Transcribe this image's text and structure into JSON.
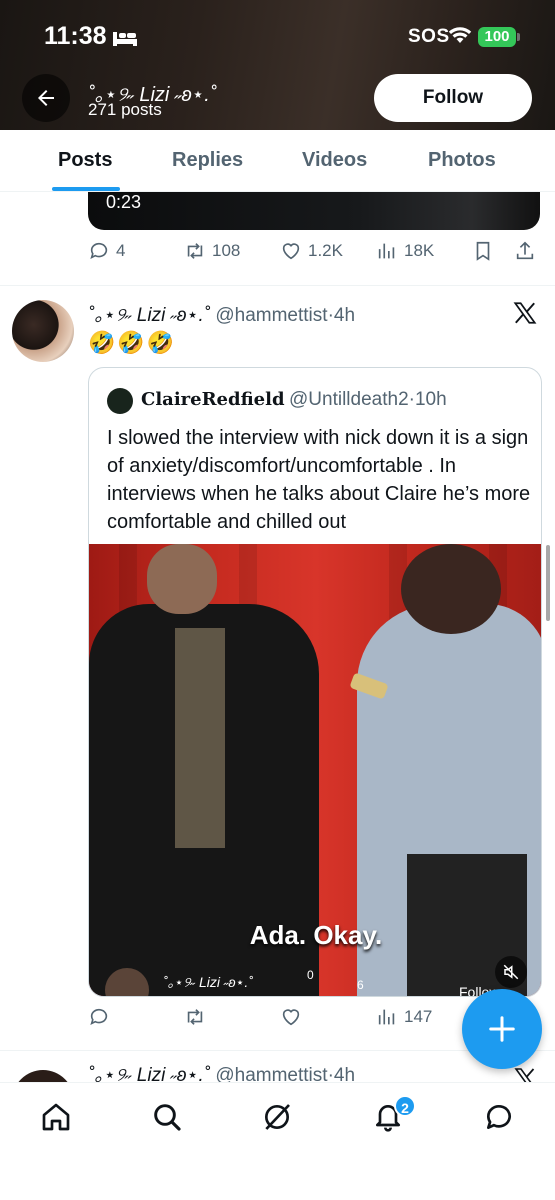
{
  "status_bar": {
    "time": "11:38",
    "sos": "SOS",
    "battery": "100"
  },
  "header": {
    "profile_name": "˚｡⋆୨˶ Lizi ˶ʚ⋆.˚",
    "post_count": "271 posts",
    "follow_label": "Follow"
  },
  "tabs": [
    {
      "label": "Posts",
      "active": true
    },
    {
      "label": "Replies",
      "active": false
    },
    {
      "label": "Videos",
      "active": false
    },
    {
      "label": "Photos",
      "active": false
    }
  ],
  "prev_tweet": {
    "video_duration": "0:23",
    "replies": "4",
    "reposts": "108",
    "likes": "1.2K",
    "views": "18K"
  },
  "tweet": {
    "display_name": "˚｡⋆୨˶ Lizi ˶ʚ⋆.˚",
    "handle": "@hammettist",
    "time": "4h",
    "text": "🤣🤣🤣",
    "quote": {
      "display_name": "ClaireRedfield",
      "handle": "@Untilldeath2",
      "time": "10h",
      "text": "I slowed the interview with nick down it is a sign of anxiety/discomfort/uncomfortable . In interviews when he talks about Claire he’s more comfortable and chilled out",
      "video_caption": "Ada. Okay.",
      "watermark_name": "˚｡⋆୨˶ Lizi ˶ʚ⋆.˚",
      "watermark_num1": "0",
      "watermark_num2": "6",
      "watermark_follow": "Follow"
    },
    "replies": "",
    "reposts": "",
    "likes": "",
    "views": "147"
  },
  "next_tweet": {
    "display_name": "˚｡⋆୨˶ Lizi ˶ʚ⋆.˚",
    "handle": "@hammettist",
    "time": "4h"
  },
  "notifications_badge": "2",
  "colors": {
    "accent": "#1d9bf0",
    "battery": "#34c759",
    "secondary_text": "#536471"
  }
}
